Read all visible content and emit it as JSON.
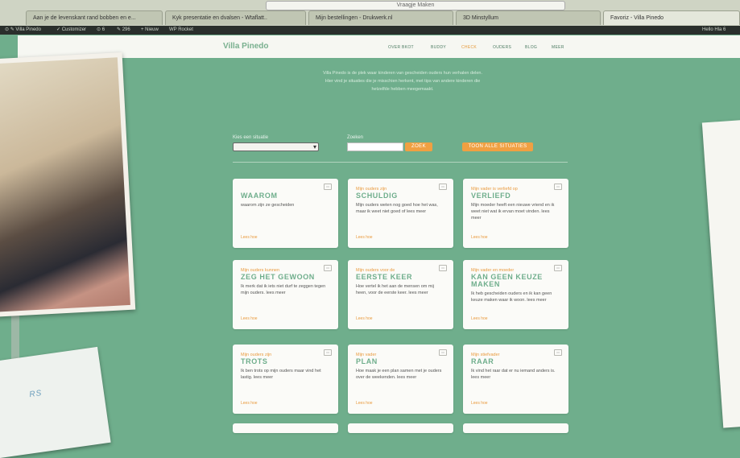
{
  "browser": {
    "url": "Vraagje Maken",
    "tabs": [
      {
        "label": "Aan je de levenskant rand bobben en e...",
        "active": false
      },
      {
        "label": "Kyk presentatie en dvalsen - Wtaflatt..",
        "active": false
      },
      {
        "label": "Mijn bestellingen - Drukwerk.nl",
        "active": false
      },
      {
        "label": "3D Minstyllum",
        "active": false
      },
      {
        "label": "Favoriz - Villa Pinedo",
        "active": true
      }
    ],
    "bookmarks": [
      "⊙ ✎ Villa Pinedo",
      "✓ Customizer",
      "⊙ 6",
      "✎ 296",
      "+ Nieuw",
      "WP Rocket",
      "Hello Hla 6"
    ]
  },
  "site": {
    "logo": "Villa Pinedo",
    "nav": [
      {
        "label": "OVER BKOT",
        "highlight": false
      },
      {
        "label": "BUDDY",
        "highlight": false
      },
      {
        "label": "CHECK",
        "highlight": true
      },
      {
        "label": "OUDERS",
        "highlight": false
      },
      {
        "label": "BLOG",
        "highlight": false
      },
      {
        "label": "MEER",
        "highlight": false
      }
    ],
    "intro": [
      "Villa Pinedo is de plek waar kinderen van gescheiden ouders hun verhalen delen.",
      "Hier vind je situaties die je misschien herkent, met tips van andere kinderen die",
      "hetzelfde hebben meegemaakt."
    ]
  },
  "filters": {
    "category_label": "Kies een situatie",
    "search_label": "Zoeken",
    "search_placeholder": "",
    "search_button": "ZOEK",
    "all_button": "TOON ALLE SITUATIES"
  },
  "cards": [
    {
      "pre": "",
      "title": "WAAROM",
      "desc": "waarom zijn ze gescheiden",
      "link": "Lees hoe"
    },
    {
      "pre": "Mijn ouders zijn",
      "title": "SCHULDIG",
      "desc": "Mijn ouders weten nog goed hoe het was, maar ik weet niet goed of lees meer",
      "link": "Lees hoe"
    },
    {
      "pre": "Mijn vader is verliefd op",
      "title": "VERLIEFD",
      "desc": "Mijn moeder heeft een nieuwe vriend en ik weet niet wat ik ervan moet vinden. lees meer",
      "link": "Lees hoe"
    },
    {
      "pre": "Mijn ouders kunnen",
      "title": "ZEG HET GEWOON",
      "desc": "Ik merk dat ik iets niet durf te zeggen tegen mijn ouders. lees meer",
      "link": "Lees hoe"
    },
    {
      "pre": "Mijn ouders voor de",
      "title": "EERSTE KEER",
      "desc": "Hoe vertel ik het aan de mensen om mij heen, voor de eerste keer. lees meer",
      "link": "Lees hoe"
    },
    {
      "pre": "Mijn vader en moeder",
      "title": "KAN GEEN KEUZE MAKEN",
      "desc": "Ik heb gescheiden ouders en ik kan geen keuze maken waar ik woon. lees meer",
      "link": "Lees hoe"
    },
    {
      "pre": "Mijn ouders zijn",
      "title": "TROTS",
      "desc": "Ik ben trots op mijn ouders maar vind het lastig. lees meer",
      "link": "Lees hoe"
    },
    {
      "pre": "Mijn vader",
      "title": "PLAN",
      "desc": "Hoe maak je een plan samen met je ouders over de weekenden. lees meer",
      "link": "Lees hoe"
    },
    {
      "pre": "Mijn stiefvader",
      "title": "RAAR",
      "desc": "Ik vind het raar dat er nu iemand anders is. lees meer",
      "link": "Lees hoe"
    }
  ],
  "overlay": {
    "bottom_left_text": "RS"
  }
}
